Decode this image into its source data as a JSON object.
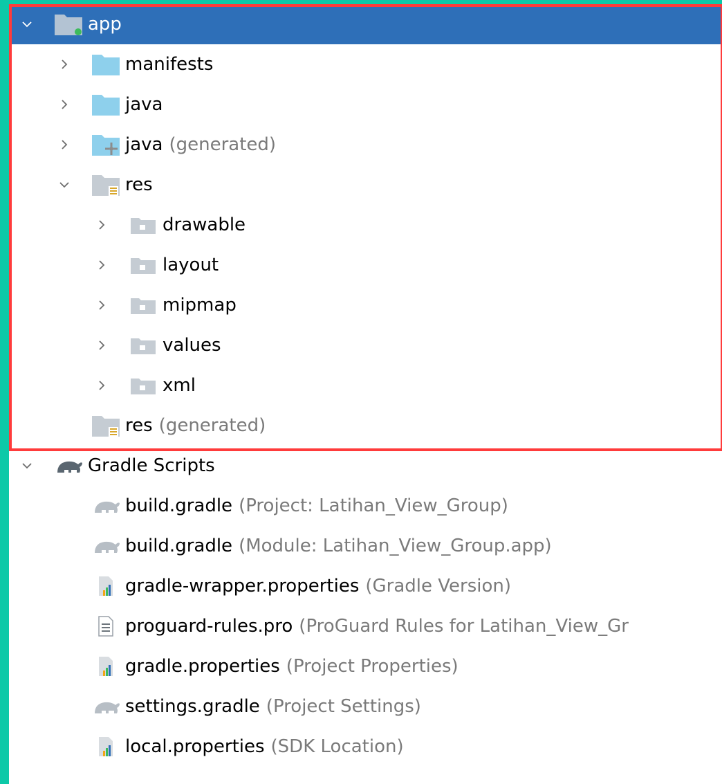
{
  "tree": {
    "items": [
      {
        "id": "app",
        "name": "app",
        "suffix": "",
        "level": 0,
        "expanded": true,
        "selected": true,
        "icon": "module-folder-icon"
      },
      {
        "id": "manifests",
        "name": "manifests",
        "suffix": "",
        "level": 1,
        "expanded": false,
        "icon": "folder-icon"
      },
      {
        "id": "java",
        "name": "java",
        "suffix": "",
        "level": 1,
        "expanded": false,
        "icon": "folder-icon"
      },
      {
        "id": "java-generated",
        "name": "java",
        "suffix": "(generated)",
        "level": 1,
        "expanded": false,
        "icon": "generated-folder-icon"
      },
      {
        "id": "res",
        "name": "res",
        "suffix": "",
        "level": 1,
        "expanded": true,
        "icon": "resource-folder-icon"
      },
      {
        "id": "drawable",
        "name": "drawable",
        "suffix": "",
        "level": 2,
        "expanded": false,
        "icon": "res-subfolder-icon"
      },
      {
        "id": "layout",
        "name": "layout",
        "suffix": "",
        "level": 2,
        "expanded": false,
        "icon": "res-subfolder-icon"
      },
      {
        "id": "mipmap",
        "name": "mipmap",
        "suffix": "",
        "level": 2,
        "expanded": false,
        "icon": "res-subfolder-icon"
      },
      {
        "id": "values",
        "name": "values",
        "suffix": "",
        "level": 2,
        "expanded": false,
        "icon": "res-subfolder-icon"
      },
      {
        "id": "xml",
        "name": "xml",
        "suffix": "",
        "level": 2,
        "expanded": false,
        "icon": "res-subfolder-icon"
      },
      {
        "id": "res-generated",
        "name": "res",
        "suffix": "(generated)",
        "level": 1,
        "expanded": null,
        "icon": "resource-folder-icon"
      },
      {
        "id": "gradle-scripts",
        "name": "Gradle Scripts",
        "suffix": "",
        "level": 0,
        "expanded": true,
        "icon": "gradle-elephant-icon"
      },
      {
        "id": "build-gradle-project",
        "name": "build.gradle",
        "suffix": "(Project: Latihan_View_Group)",
        "level": 1,
        "expanded": null,
        "icon": "gradle-file-icon"
      },
      {
        "id": "build-gradle-module",
        "name": "build.gradle",
        "suffix": "(Module: Latihan_View_Group.app)",
        "level": 1,
        "expanded": null,
        "icon": "gradle-file-icon"
      },
      {
        "id": "gradle-wrapper-properties",
        "name": "gradle-wrapper.properties",
        "suffix": "(Gradle Version)",
        "level": 1,
        "expanded": null,
        "icon": "properties-file-icon"
      },
      {
        "id": "proguard-rules",
        "name": "proguard-rules.pro",
        "suffix": "(ProGuard Rules for Latihan_View_Gr",
        "level": 1,
        "expanded": null,
        "icon": "text-file-icon"
      },
      {
        "id": "gradle-properties",
        "name": "gradle.properties",
        "suffix": "(Project Properties)",
        "level": 1,
        "expanded": null,
        "icon": "properties-file-icon"
      },
      {
        "id": "settings-gradle",
        "name": "settings.gradle",
        "suffix": "(Project Settings)",
        "level": 1,
        "expanded": null,
        "icon": "gradle-file-icon"
      },
      {
        "id": "local-properties",
        "name": "local.properties",
        "suffix": "(SDK Location)",
        "level": 1,
        "expanded": null,
        "icon": "properties-file-icon"
      }
    ]
  },
  "colors": {
    "selection": "#2e6fb8",
    "folder": "#8ed0ec",
    "highlight_border": "#ff3b3b",
    "accent_strip": "#0cc9a8",
    "suffix_text": "#7a7a7a"
  }
}
